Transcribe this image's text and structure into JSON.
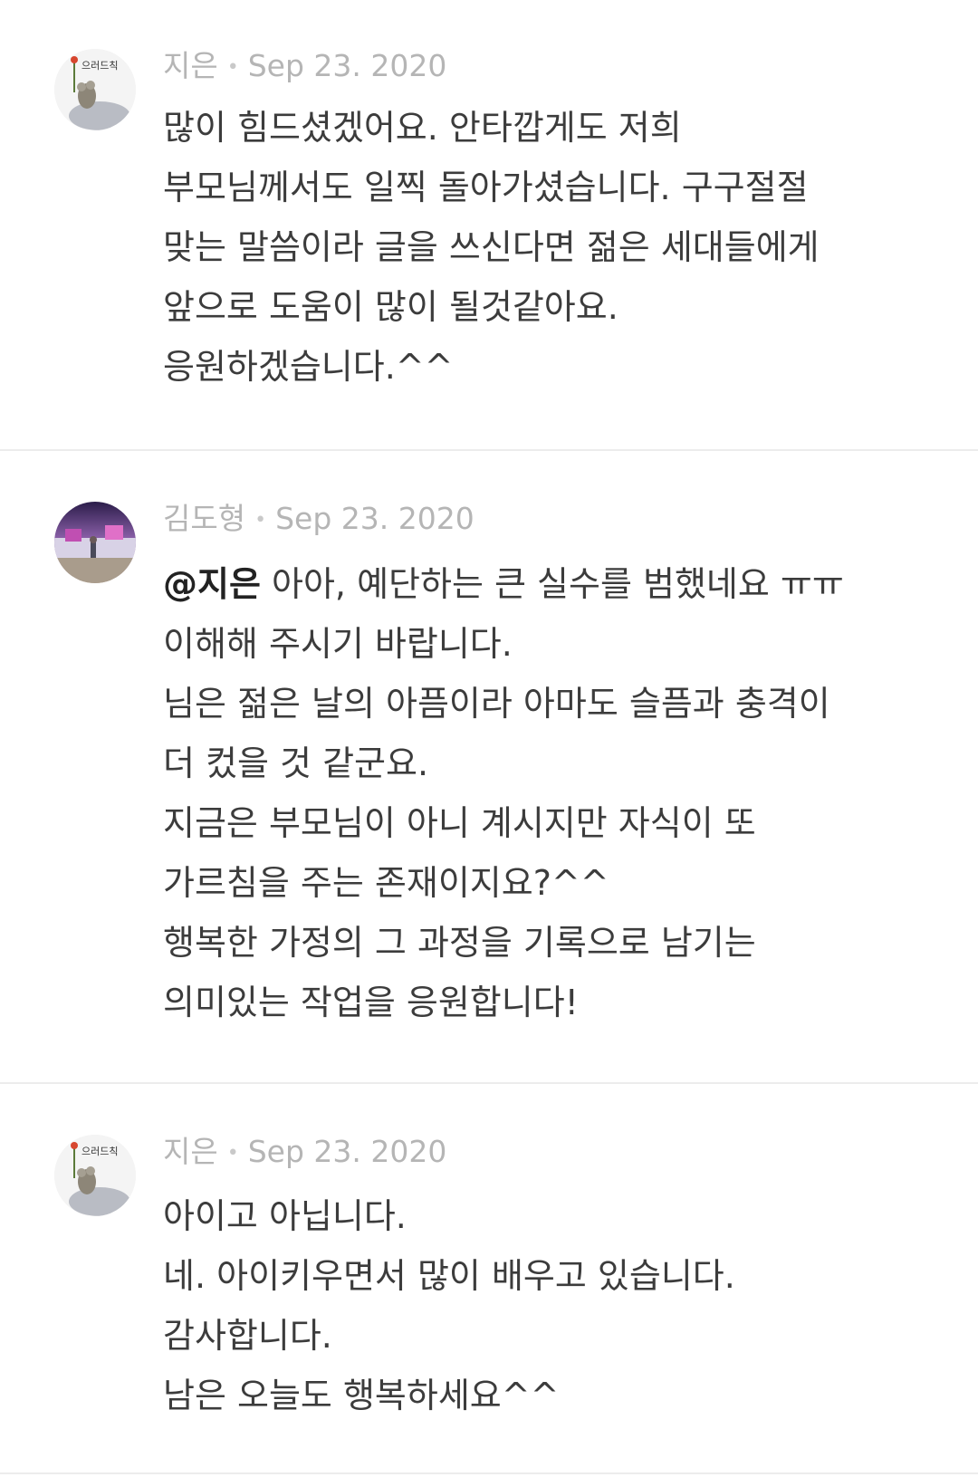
{
  "comments": [
    {
      "author": "지은",
      "date": "Sep 23. 2020",
      "avatar_icon": "profile-avatar-mouse-flower",
      "lines": [
        "많이 힘드셨겠어요.  안타깝게도 저희",
        "부모님께서도 일찍 돌아가셨습니다. 구구절절",
        "맞는 말씀이라 글을 쓰신다면 젊은 세대들에게",
        "앞으로 도움이 많이 될것같아요.",
        "응원하겠습니다.^^"
      ]
    },
    {
      "author": "김도형",
      "date": "Sep 23. 2020",
      "avatar_icon": "profile-avatar-photo",
      "mention": "@지은",
      "first_line_rest": " 아아, 예단하는 큰 실수를 범했네요 ㅠㅠ",
      "lines": [
        "이해해 주시기 바랍니다.",
        "님은 젊은 날의 아픔이라 아마도 슬픔과 충격이",
        "더 컸을 것 같군요.",
        "지금은 부모님이 아니 계시지만 자식이 또",
        "가르침을 주는 존재이지요?^^",
        "행복한 가정의 그 과정을 기록으로 남기는",
        "의미있는 작업을 응원합니다!"
      ]
    },
    {
      "author": "지은",
      "date": "Sep 23. 2020",
      "avatar_icon": "profile-avatar-mouse-flower",
      "lines": [
        "아이고 아닙니다.",
        "네. 아이키우면서 많이 배우고 있습니다.",
        "감사합니다.",
        "남은 오늘도 행복하세요^^"
      ]
    }
  ],
  "separator": "•",
  "avatar_logo_text": "으러드칙"
}
